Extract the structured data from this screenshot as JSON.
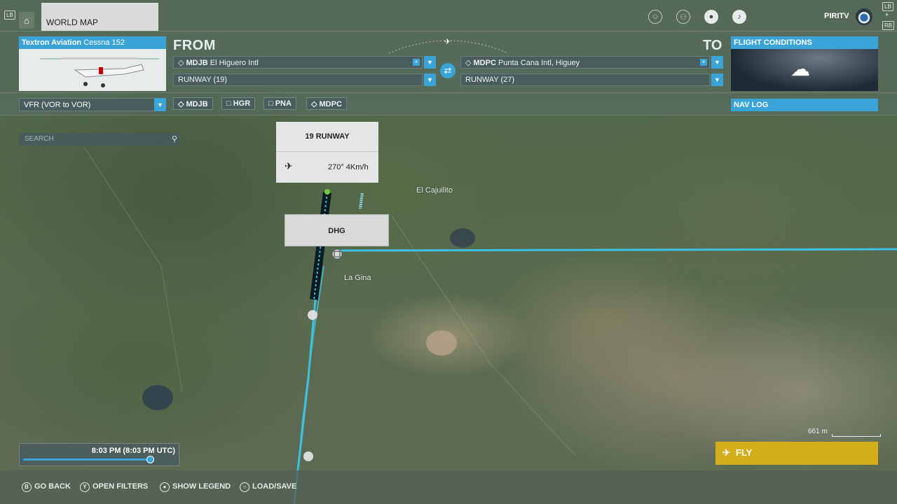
{
  "topbar": {
    "tab_label": "WORLD MAP",
    "lb": "LB",
    "rb": "RB",
    "plus": "+",
    "lb2": "LB",
    "username": "PIRITV"
  },
  "aircraft": {
    "make": "Textron Aviation",
    "model": "Cessna 152"
  },
  "from": {
    "label": "FROM",
    "airport_code": "MDJB",
    "airport_name": "El Higuero Intl",
    "runway": "RUNWAY (19)"
  },
  "to": {
    "label": "TO",
    "airport_code": "MDPC",
    "airport_name": "Punta Cana Intl, Higuey",
    "runway": "RUNWAY (27)"
  },
  "conditions": {
    "label": "FLIGHT CONDITIONS"
  },
  "navlog": {
    "label": "NAV LOG"
  },
  "flight_type": "VFR (VOR to VOR)",
  "waypoints": [
    "MDJB",
    "HGR",
    "PNA",
    "MDPC"
  ],
  "search": {
    "placeholder": "SEARCH"
  },
  "runway_popup": {
    "runway_num": "19",
    "runway_label": "RUNWAY",
    "wind": "270° 4Km/h"
  },
  "waypoint_popup": {
    "label": "DHG"
  },
  "places": {
    "a": "El Cajuilito",
    "b": "La Gina"
  },
  "time": {
    "display": "8:03 PM (8:03 PM UTC)"
  },
  "scale": {
    "label": "661 m"
  },
  "fly": {
    "label": "FLY"
  },
  "hints": {
    "back": "GO BACK",
    "filters": "OPEN FILTERS",
    "legend": "SHOW LEGEND",
    "loadsave": "LOAD/SAVE",
    "b": "B",
    "y": "Y"
  },
  "colors": {
    "accent": "#3aa3d8",
    "fly": "#d4ad1a",
    "route": "#3fc0e0"
  }
}
